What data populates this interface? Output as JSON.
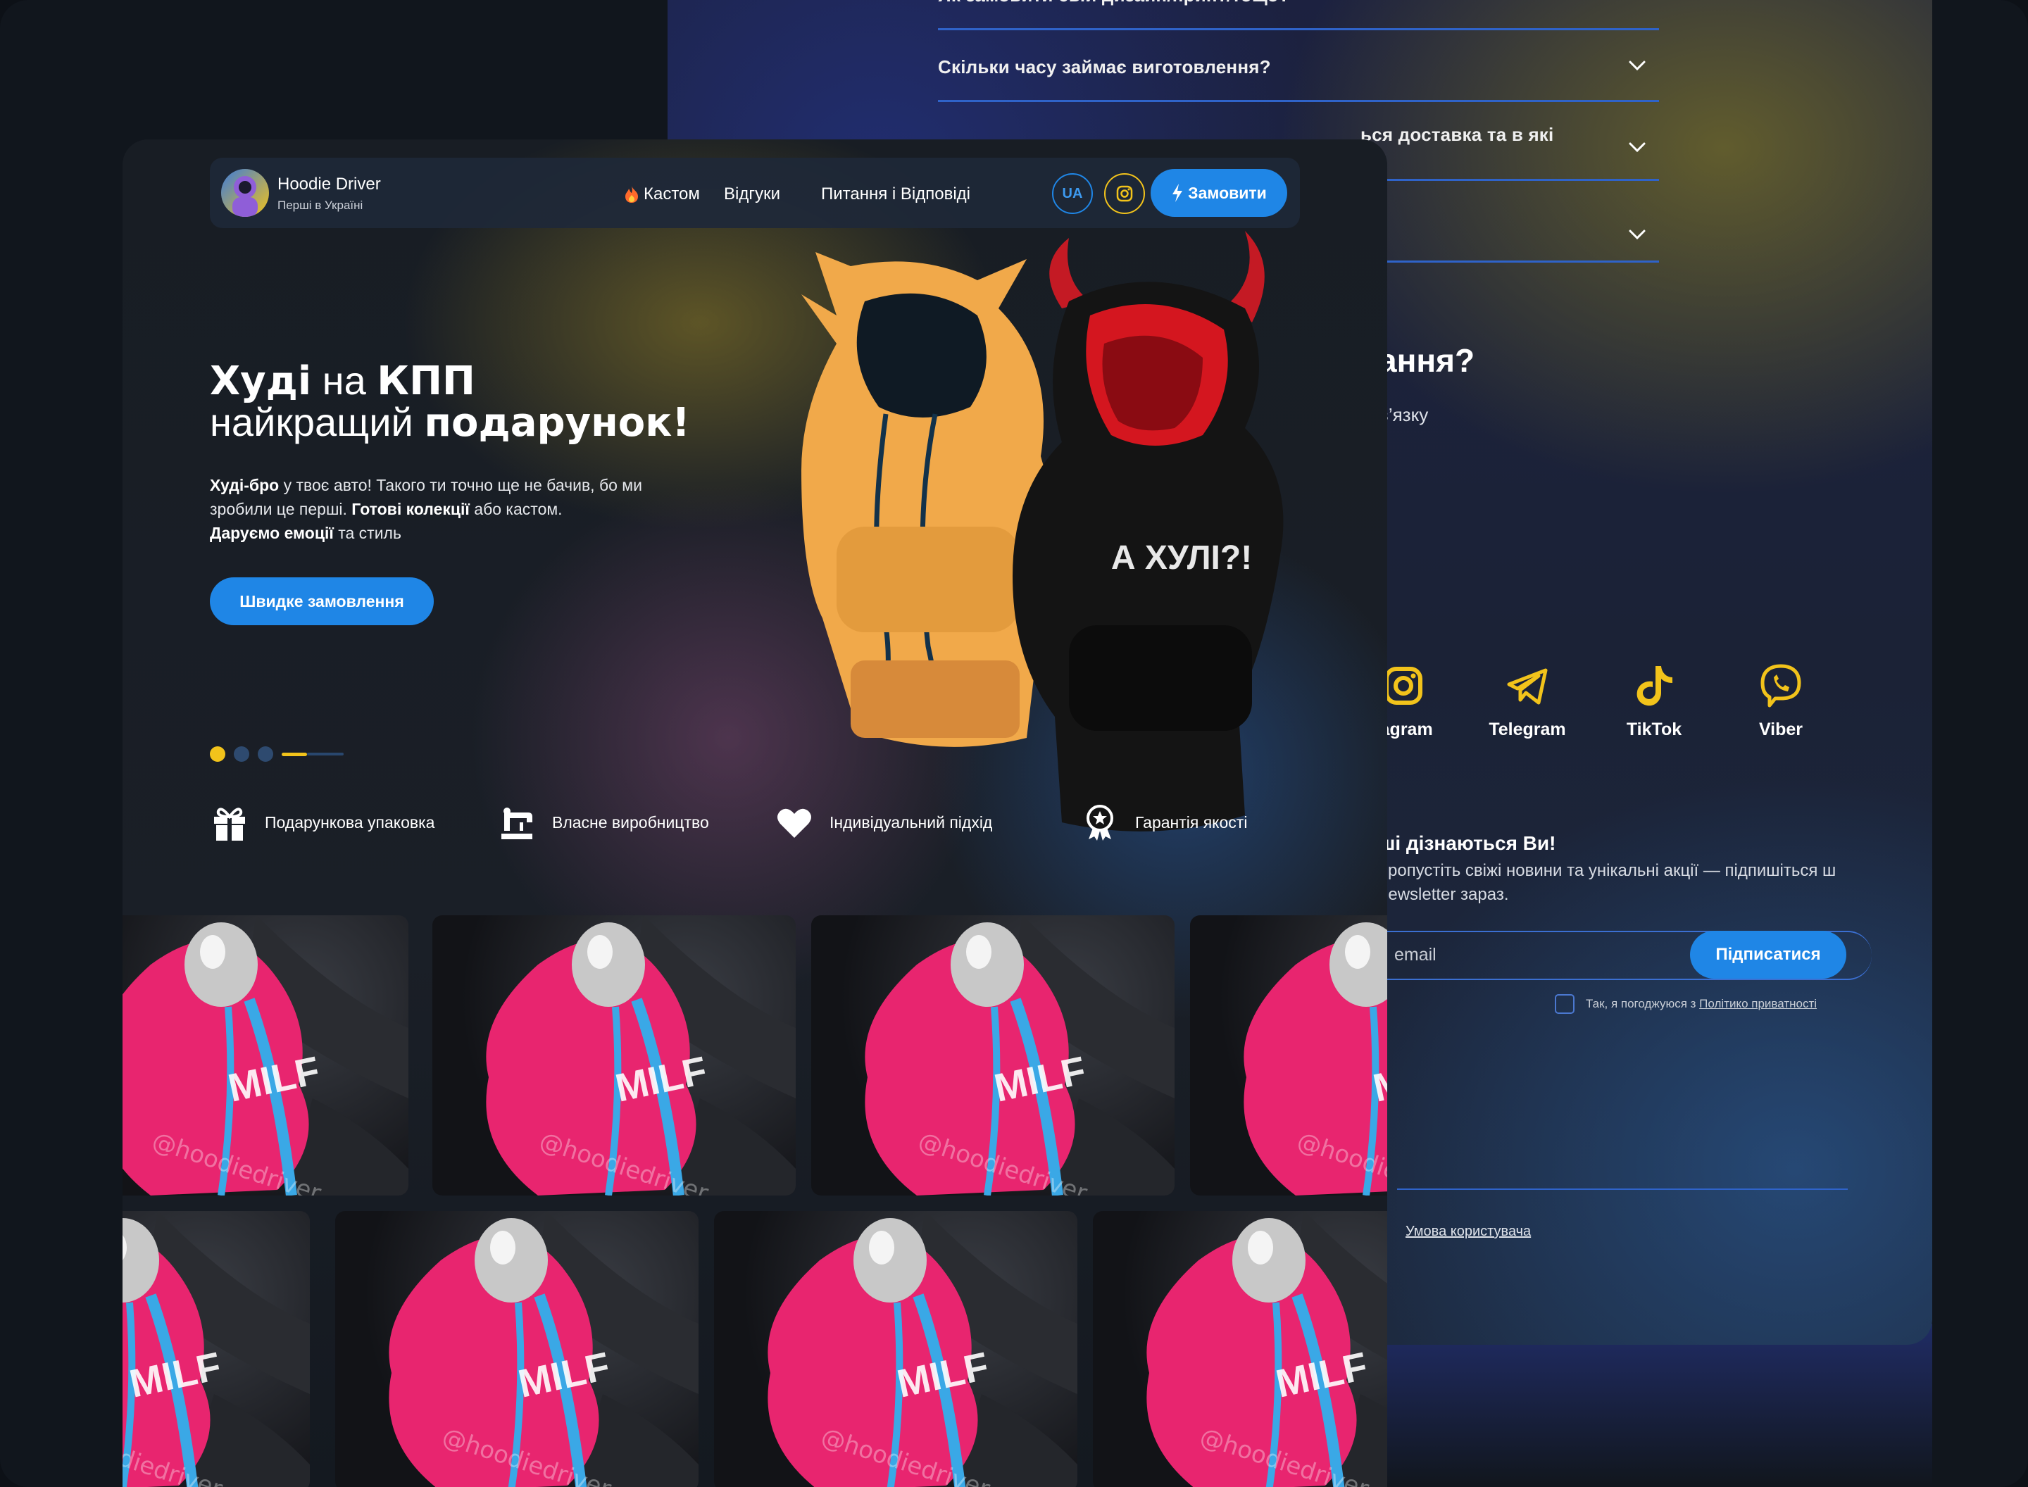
{
  "faq": {
    "items": [
      "Як замовити свій дизайн/принт/тощо?",
      "Скільки часу займає виготовлення?",
      "ься доставка та в які",
      ""
    ]
  },
  "contact": {
    "heading": "ання?",
    "subheading": "в’язку"
  },
  "socials": [
    {
      "label": "tagram",
      "icon": "instagram-icon"
    },
    {
      "label": "Telegram",
      "icon": "telegram-icon"
    },
    {
      "label": "TikTok",
      "icon": "tiktok-icon"
    },
    {
      "label": "Viber",
      "icon": "viber-icon"
    }
  ],
  "newsletter": {
    "title": "ші дізнаються Ви!",
    "text": "пропустіть свіжі новини та унікальні акції — підпишіться ш newsletter зараз.",
    "email_placeholder": "email",
    "subscribe_label": "Підписатися",
    "consent_text": "Так, я погоджуюся з",
    "consent_link": "Політико приватності"
  },
  "footer": {
    "terms_link": "Умова користувача"
  },
  "nav": {
    "brand_name": "Hoodie Driver",
    "brand_sub": "Перші в Україні",
    "links": [
      "Кастом",
      "Відгуки",
      "Питання і Відповіді"
    ],
    "lang": "UA",
    "order_label": "Замовити"
  },
  "hero": {
    "title_part1": "Худі",
    "title_part2": " на ",
    "title_part3": "КПП",
    "title_line2_part1": "найкращий ",
    "title_line2_part2": "подарунок!",
    "p1_bold": "Худі-бро",
    "p1_text": " у твоє авто! Такого ти точно ще не бачив, бо ми зробили це перші. ",
    "p2_bold": "Готові колекції",
    "p2_text": " або кастом.",
    "p3_bold": "Даруємо емоції",
    "p3_text": " та стиль",
    "cta_label": "Швидке замовлення",
    "hoodie_print": "А ХУЛІ?!"
  },
  "features": [
    {
      "label": "Подарункова упаковка",
      "icon": "gift-icon"
    },
    {
      "label": "Власне виробництво",
      "icon": "sewing-machine-icon"
    },
    {
      "label": "Індивідуальний підхід",
      "icon": "heart-icon"
    },
    {
      "label": "Гарантія якості",
      "icon": "quality-badge-icon"
    }
  ],
  "gallery": {
    "image_text": "MILF",
    "watermark": "@hoodiedriver"
  },
  "colors": {
    "accent_blue": "#1f86e6",
    "accent_yellow": "#f2c31b",
    "hoodie_pink": "#e8256f"
  }
}
